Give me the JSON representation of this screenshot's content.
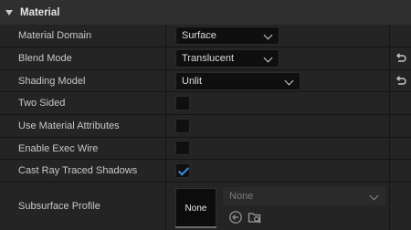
{
  "section": {
    "title": "Material"
  },
  "properties": [
    {
      "label": "Material Domain",
      "value": "Surface"
    },
    {
      "label": "Blend Mode",
      "value": "Translucent"
    },
    {
      "label": "Shading Model",
      "value": "Unlit"
    },
    {
      "label": "Two Sided",
      "checked": false
    },
    {
      "label": "Use Material Attributes",
      "checked": false
    },
    {
      "label": "Enable Exec Wire",
      "checked": false
    },
    {
      "label": "Cast Ray Traced Shadows",
      "checked": true
    }
  ],
  "subsurface": {
    "label": "Subsurface Profile",
    "thumbnail_text": "None",
    "dropdown_value": "None"
  },
  "colors": {
    "accent": "#3b8fe0",
    "header_bg": "#2f2f2f",
    "row_bg": "#242424"
  },
  "icons": {
    "reset": "reset-to-default-arrow",
    "use_selected": "use-selected-asset-arrow",
    "browse": "browse-asset-folder"
  }
}
